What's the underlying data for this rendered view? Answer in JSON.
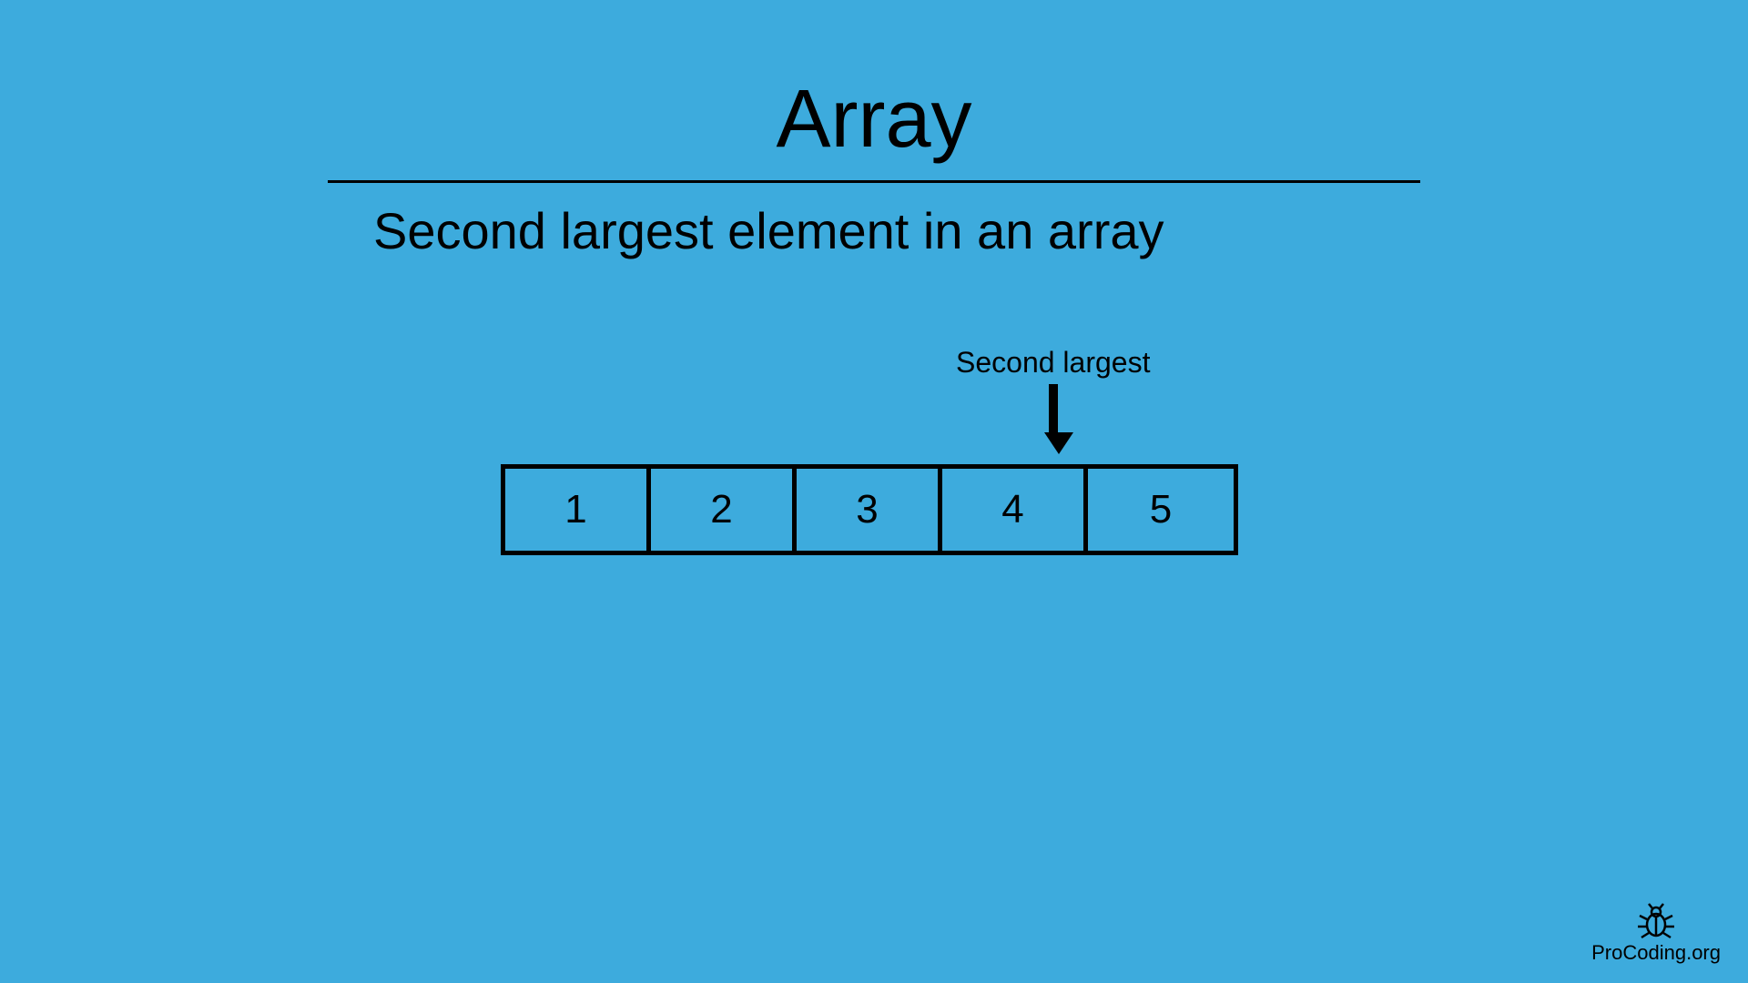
{
  "title": "Array",
  "subtitle": "Second largest element in an array",
  "annotation": "Second largest",
  "cells": [
    "1",
    "2",
    "3",
    "4",
    "5"
  ],
  "highlight_index": 3,
  "footer": "ProCoding.org"
}
